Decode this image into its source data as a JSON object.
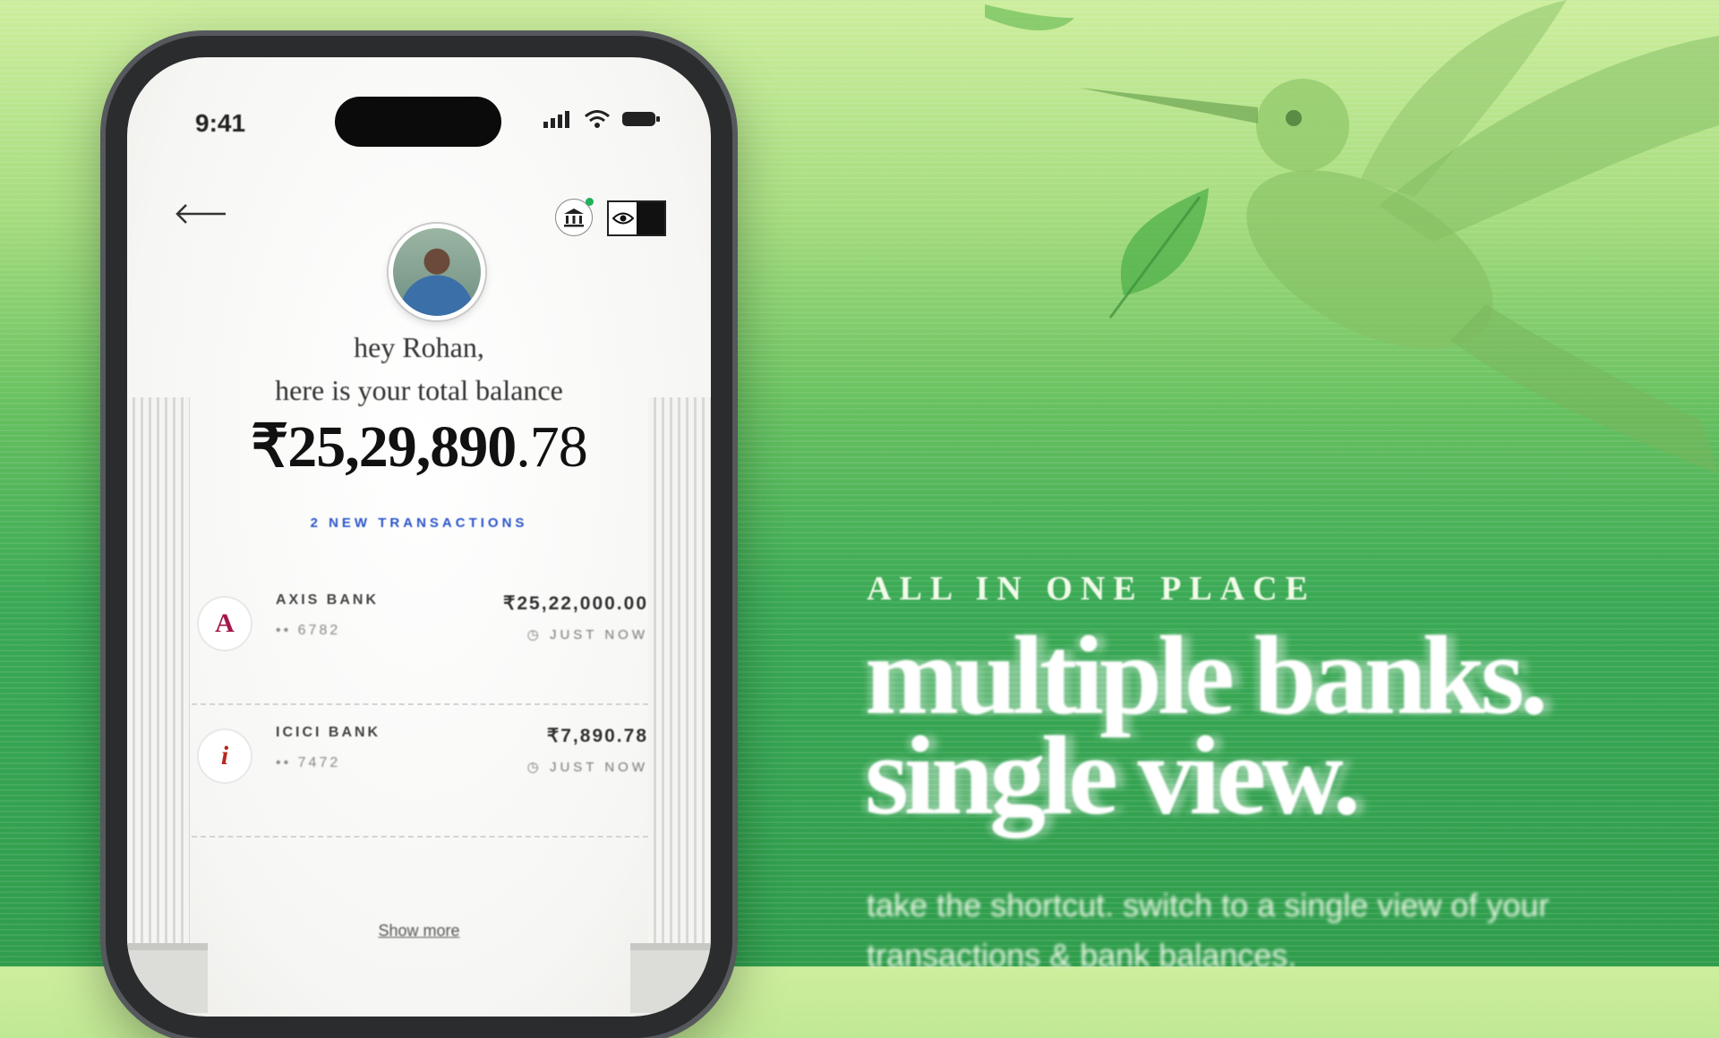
{
  "phone": {
    "status_bar": {
      "time": "9:41"
    },
    "greeting_line1": "hey Rohan,",
    "greeting_line2": "here is your total balance",
    "balance_main": "₹25,29,890",
    "balance_paise": ".78",
    "new_transactions": "2 NEW TRANSACTIONS",
    "transactions": [
      {
        "bank": "AXIS BANK",
        "account": "•• 6782",
        "amount": "₹25,22,000.00",
        "time": "JUST NOW",
        "logo_glyph": "A",
        "logo_color": "#a3174a"
      },
      {
        "bank": "ICICI BANK",
        "account": "•• 7472",
        "amount": "₹7,890.78",
        "time": "JUST NOW",
        "logo_glyph": "i",
        "logo_color": "#b5291f"
      }
    ],
    "show_more": "Show more",
    "icons": {
      "back": "back-arrow-icon",
      "bank": "bank-icon",
      "eye": "eye-icon"
    }
  },
  "promo": {
    "kicker": "ALL IN ONE PLACE",
    "headline_line1": "multiple banks.",
    "headline_line2": "single view.",
    "subcopy_line1": "take the shortcut. switch to a single view of your",
    "subcopy_line2": "transactions & bank balances."
  },
  "colors": {
    "background_top": "#cdee9e",
    "background_bottom": "#2f9d4c",
    "accent_blue": "#2b55c9"
  }
}
